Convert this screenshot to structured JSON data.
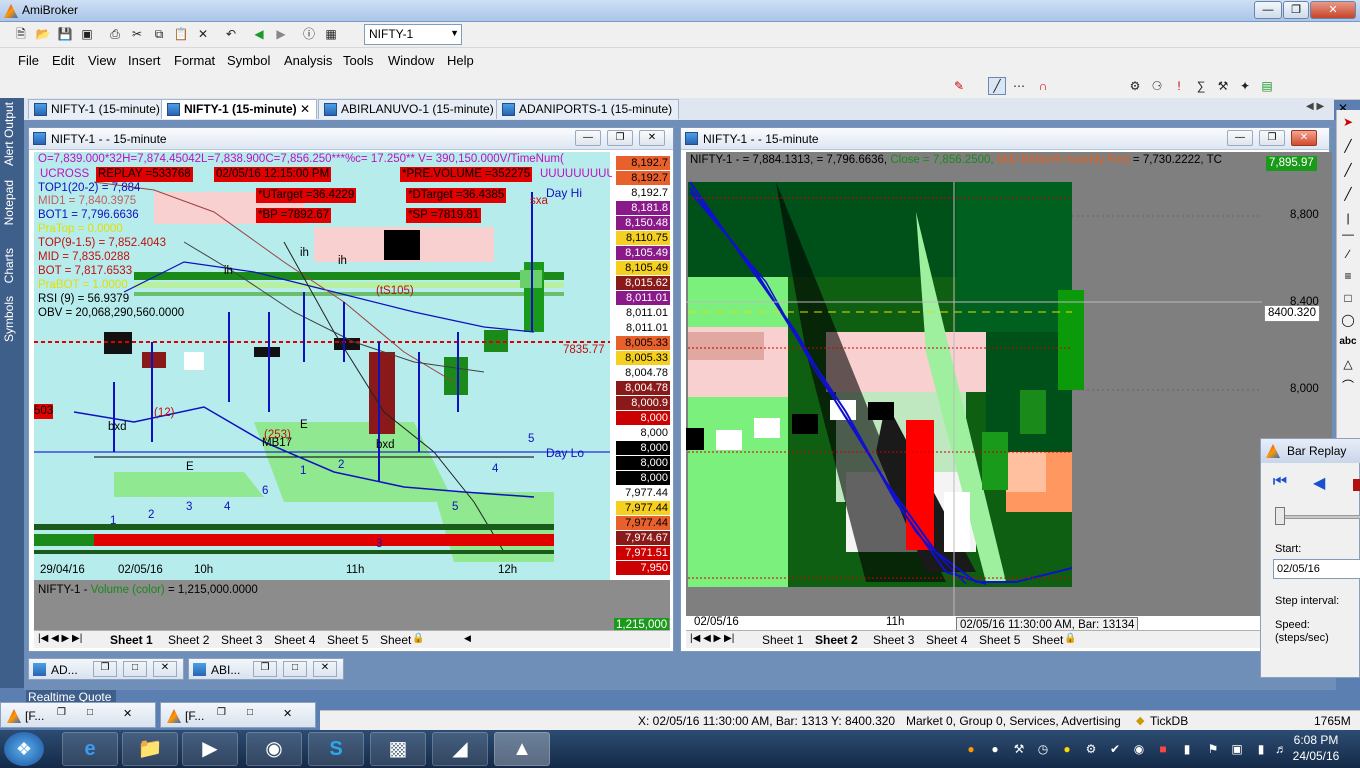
{
  "app": {
    "title": "AmiBroker"
  },
  "toolbar": {
    "symbol": "NIFTY-1"
  },
  "menu": [
    "File",
    "Edit",
    "View",
    "Insert",
    "Format",
    "Symbol",
    "Analysis",
    "Tools",
    "Window",
    "Help"
  ],
  "tabs": [
    "NIFTY-1 (15-minute)",
    "NIFTY-1 (15-minute)",
    "ABIRLANUVO-1 (15-minute)",
    "ADANIPORTS-1 (15-minute)"
  ],
  "side_panels": [
    "Alert Output",
    "Notepad",
    "Charts",
    "Symbols"
  ],
  "left_chart": {
    "title": "NIFTY-1 -  - 15-minute",
    "ohlc_line": "O=7,839.000*32H=7,874.45042L=7,838.900C=7,856.250***%c= 17.250** V= 390,150.000V/TimeNum(",
    "ucross": "UCROSS",
    "uuu": "UUUUUUUUU",
    "replay": "REPLAY  =533768",
    "date_box": "02/05/16 12:15:00 PM",
    "pre_volume": "*PRE.VOLUME =352275",
    "utarget": "*UTarget =36.4229",
    "dtarget": "*DTarget =36.4385",
    "bp": "*BP =7892.67",
    "sp": "*SP =7819.81",
    "sxa": "sxa",
    "day_hi": "Day Hi",
    "day_lo": "Day Lo",
    "top1": "TOP1(20-2) =  7,884",
    "mid1": "MID1 = 7,840.3975",
    "bot1": "BOT1 = 7,796.6636",
    "pratop": "PraTop = 0.0000",
    "top9": "TOP(9-1.5) = 7,852.4043",
    "mid": "MID = 7,835.0288",
    "bot": "BOT = 7,817.6533",
    "prabot": "PraBOT = 1.0000",
    "rsi": "RSI (9) =  56.9379",
    "obv": "OBV = 20,068,290,560.0000",
    "ts": "(tS105)",
    "val_7835": "7835.77",
    "val_503": "503",
    "ih1": "ih",
    "ih2": "ih",
    "ih3": "ih",
    "mb17": "MB17",
    "x253": "(253)",
    "bxd1": "bxd",
    "bxd2": "bxd",
    "e1": "E",
    "e2": "E",
    "x12": "(12)",
    "x_axis": [
      "29/04/16",
      "02/05/16",
      "10h",
      "11h",
      "12h"
    ],
    "wave_labels": [
      "1",
      "2",
      "3",
      "4",
      "5",
      "6",
      "1",
      "2",
      "3",
      "4",
      "5",
      "1",
      "2"
    ],
    "volume_label": "NIFTY-1 - ",
    "volume_color_text": "Volume (color)",
    "volume_value": "= 1,215,000.0000",
    "volume_right": "1,215,000",
    "price_labels": [
      {
        "v": "8,192.7",
        "bg": "#e8602c"
      },
      {
        "v": "8,192.7",
        "bg": "#e8602c"
      },
      {
        "v": "8,192.7",
        "bg": "#ffffff"
      },
      {
        "v": "8,181.8",
        "bg": "#8a1a8a"
      },
      {
        "v": "8,150.48",
        "bg": "#8a1a8a"
      },
      {
        "v": "8,110.75",
        "bg": "#f5d020"
      },
      {
        "v": "8,105.49",
        "bg": "#8a1a8a"
      },
      {
        "v": "8,105.49",
        "bg": "#f5d020"
      },
      {
        "v": "8,015.62",
        "bg": "#8a1a1a"
      },
      {
        "v": "8,011.01",
        "bg": "#8a1a8a"
      },
      {
        "v": "8,011.01",
        "bg": "#ffffff"
      },
      {
        "v": "8,011.01",
        "bg": "#ffffff"
      },
      {
        "v": "8,005.33",
        "bg": "#e8602c"
      },
      {
        "v": "8,005.33",
        "bg": "#f5d020"
      },
      {
        "v": "8,004.78",
        "bg": "#ffffff"
      },
      {
        "v": "8,004.78",
        "bg": "#8a1a1a"
      },
      {
        "v": "8,000.9",
        "bg": "#8a1a1a"
      },
      {
        "v": "8,000",
        "bg": "#cc0000"
      },
      {
        "v": "8,000",
        "bg": "#ffffff"
      },
      {
        "v": "8,000",
        "bg": "#000000"
      },
      {
        "v": "8,000",
        "bg": "#000000"
      },
      {
        "v": "8,000",
        "bg": "#000000"
      },
      {
        "v": "7,977.44",
        "bg": "#ffffff"
      },
      {
        "v": "7,977.44",
        "bg": "#f5d020"
      },
      {
        "v": "7,977.44",
        "bg": "#e8602c"
      },
      {
        "v": "7,974.67",
        "bg": "#8a1a1a"
      },
      {
        "v": "7,971.51",
        "bg": "#cc0000"
      },
      {
        "v": "7,950",
        "bg": "#cc0000"
      }
    ],
    "sheets": [
      "Sheet 1",
      "Sheet 2",
      "Sheet 3",
      "Sheet 4",
      "Sheet 5",
      "Sheet"
    ]
  },
  "right_chart": {
    "title": "NIFTY-1 -  - 15-minute",
    "info_line_a": "NIFTY-1 -  = 7,884.1313,  = 7,796.6636, ",
    "info_close": "Close = 7,856.2500, ",
    "info_mid": "MID BANm9 monthly First",
    "info_end": " = 7,730.2222, TC",
    "price_top": "7,895.97",
    "y_ticks": [
      "8,800",
      "8,400",
      "8,000"
    ],
    "crosshair_value": "8400.320",
    "x_axis": [
      "02/05/16",
      "11h"
    ],
    "tooltip": "02/05/16 11:30:00 AM, Bar: 13134",
    "sheets": [
      "Sheet 1",
      "Sheet 2",
      "Sheet 3",
      "Sheet 4",
      "Sheet 5",
      "Sheet"
    ]
  },
  "bar_replay": {
    "title": "Bar Replay",
    "start_label": "Start:",
    "start_value": "02/05/16",
    "step_label": "Step interval:",
    "speed_label": "Speed:",
    "speed_unit": "(steps/sec)"
  },
  "minimized": [
    "AD...",
    "ABI..."
  ],
  "realtime_quote": "Realtime Quote",
  "mini_tasks": [
    "[F...",
    "[F..."
  ],
  "status": {
    "coords": "X: 02/05/16 11:30:00 AM, Bar: 1313  Y: 8400.320",
    "market": "Market 0, Group 0, Services, Advertising",
    "db": "TickDB",
    "mem": "1765M"
  },
  "clock": {
    "time": "6:08 PM",
    "date": "24/05/16"
  }
}
